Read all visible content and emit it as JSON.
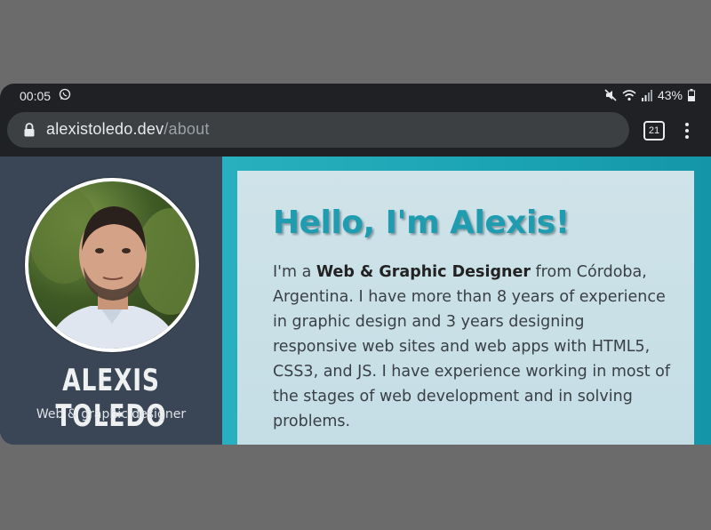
{
  "status_bar": {
    "time": "00:05",
    "battery": "43%"
  },
  "browser": {
    "url_host": "alexistoledo.dev",
    "url_path": "/about",
    "tab_count": "21"
  },
  "profile": {
    "name": "ALEXIS TOLEDO",
    "role": "Web & graphic designer"
  },
  "about": {
    "heading": "Hello, I'm Alexis!",
    "bio_prefix": "I'm a ",
    "bio_bold": "Web & Graphic Designer",
    "bio_rest": " from Córdoba, Argentina. I have more than 8 years of experience in graphic design and 3 years designing responsive web sites and web apps with HTML5, CSS3, and JS. I have experience working in most of the stages of web development and in solving problems."
  },
  "icons": [
    "whatsapp-icon",
    "mute-icon",
    "wifi-icon",
    "signal-icon",
    "battery-icon",
    "lock-icon",
    "tab-switcher-icon",
    "more-menu-icon"
  ],
  "colors": {
    "accent": "#1f9cb0",
    "sidebar_bg": "#3a4655",
    "card_bg": "#cfe3e9"
  }
}
